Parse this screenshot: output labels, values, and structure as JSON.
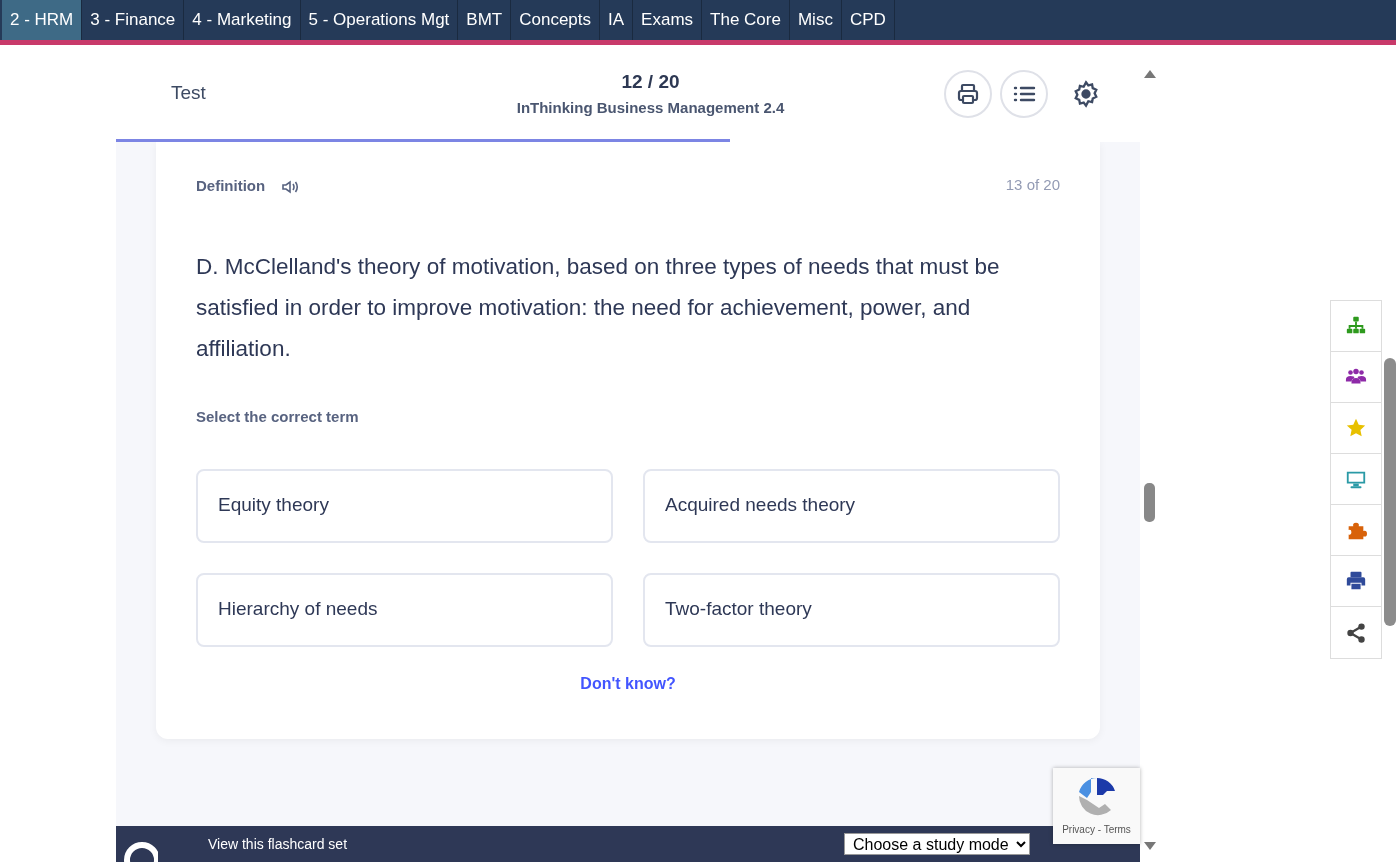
{
  "nav_tabs": [
    {
      "label": "2 - HRM",
      "selected": true
    },
    {
      "label": "3 - Finance",
      "selected": false
    },
    {
      "label": "4 - Marketing",
      "selected": false
    },
    {
      "label": "5 - Operations Mgt",
      "selected": false
    },
    {
      "label": "BMT",
      "selected": false
    },
    {
      "label": "Concepts",
      "selected": false
    },
    {
      "label": "IA",
      "selected": false
    },
    {
      "label": "Exams",
      "selected": false
    },
    {
      "label": "The Core",
      "selected": false
    },
    {
      "label": "Misc",
      "selected": false
    },
    {
      "label": "CPD",
      "selected": false
    }
  ],
  "header": {
    "mode": "Test",
    "count": "12 / 20",
    "set_title": "InThinking Business Management 2.4",
    "progress": {
      "level": 0.6
    }
  },
  "card": {
    "label": "Definition",
    "position": "13 of 20",
    "definition": "D. McClelland's theory of motivation, based on three types of needs that must be satisfied in order to improve motivation: the need for achievement, power, and affiliation.",
    "prompt": "Select the correct term",
    "options": [
      "Equity theory",
      "Acquired needs theory",
      "Hierarchy of needs",
      "Two-factor theory"
    ],
    "dont_know": "Don't know?"
  },
  "side_toolbar": [
    {
      "kind": "sitemap",
      "color": "#2e9a1e"
    },
    {
      "kind": "users",
      "color": "#8e2aa8"
    },
    {
      "kind": "star",
      "color": "#e8c000"
    },
    {
      "kind": "monitor",
      "color": "#2a9aa6"
    },
    {
      "kind": "puzzle",
      "color": "#d8620a"
    },
    {
      "kind": "print",
      "color": "#2f4a9a"
    },
    {
      "kind": "share",
      "color": "#444444"
    }
  ],
  "footer": {
    "link": "View this flashcard set",
    "select": "Choose a study mode"
  },
  "recaptcha": {
    "links": "Privacy - Terms"
  }
}
